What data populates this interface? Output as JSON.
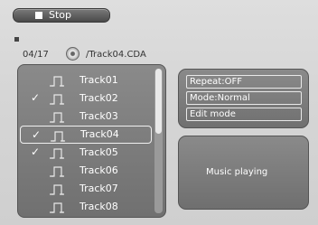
{
  "toolbar": {
    "stop_label": "Stop"
  },
  "header": {
    "track_count": "04/17",
    "current_path": "/Track04.CDA"
  },
  "playlist": {
    "tracks": [
      {
        "name": "Track01",
        "checked": false
      },
      {
        "name": "Track02",
        "checked": true
      },
      {
        "name": "Track03",
        "checked": false
      },
      {
        "name": "Track04",
        "checked": true
      },
      {
        "name": "Track05",
        "checked": true
      },
      {
        "name": "Track06",
        "checked": false
      },
      {
        "name": "Track07",
        "checked": false
      },
      {
        "name": "Track08",
        "checked": false
      }
    ],
    "selected": "Track04"
  },
  "options": {
    "repeat": "Repeat:OFF",
    "mode": "Mode:Normal",
    "edit": "Edit mode"
  },
  "status": {
    "text": "Music playing"
  }
}
